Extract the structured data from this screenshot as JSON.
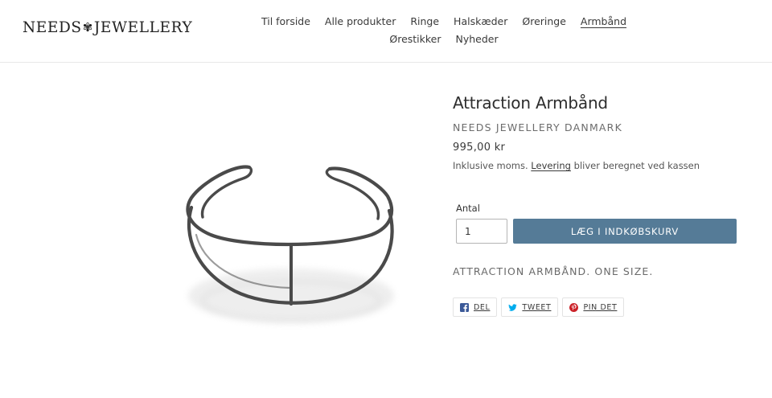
{
  "brand": {
    "name_left": "NEEDS",
    "flower_glyph": "✾",
    "name_right": "JEWELLERY"
  },
  "nav": {
    "items": [
      {
        "label": "Til forside"
      },
      {
        "label": "Alle produkter"
      },
      {
        "label": "Ringe"
      },
      {
        "label": "Halskæder"
      },
      {
        "label": "Øreringe"
      },
      {
        "label": "Armbånd",
        "active": true
      },
      {
        "label": "Ørestikker"
      },
      {
        "label": "Nyheder"
      }
    ]
  },
  "product": {
    "title": "Attraction Armbånd",
    "vendor": "NEEDS JEWELLERY DANMARK",
    "price": "995,00 kr",
    "tax_prefix": "Inklusive moms.",
    "tax_link": "Levering",
    "tax_suffix": "bliver beregnet ved kassen",
    "quantity_label": "Antal",
    "quantity_value": "1",
    "add_to_cart": "LÆG I INDKØBSKURV",
    "description": "ATTRACTION ARMBÅND. ONE SIZE.",
    "image_alt": "Attraction Armbånd"
  },
  "share": {
    "facebook": {
      "label": "DEL",
      "icon": "facebook-icon",
      "color": "#3b5998"
    },
    "twitter": {
      "label": "TWEET",
      "icon": "twitter-icon",
      "color": "#00aced"
    },
    "pinterest": {
      "label": "PIN DET",
      "icon": "pinterest-icon",
      "color": "#cb2027"
    }
  },
  "colors": {
    "button": "#557b97",
    "text": "#3a3a3a",
    "muted": "#6c6c6c"
  }
}
